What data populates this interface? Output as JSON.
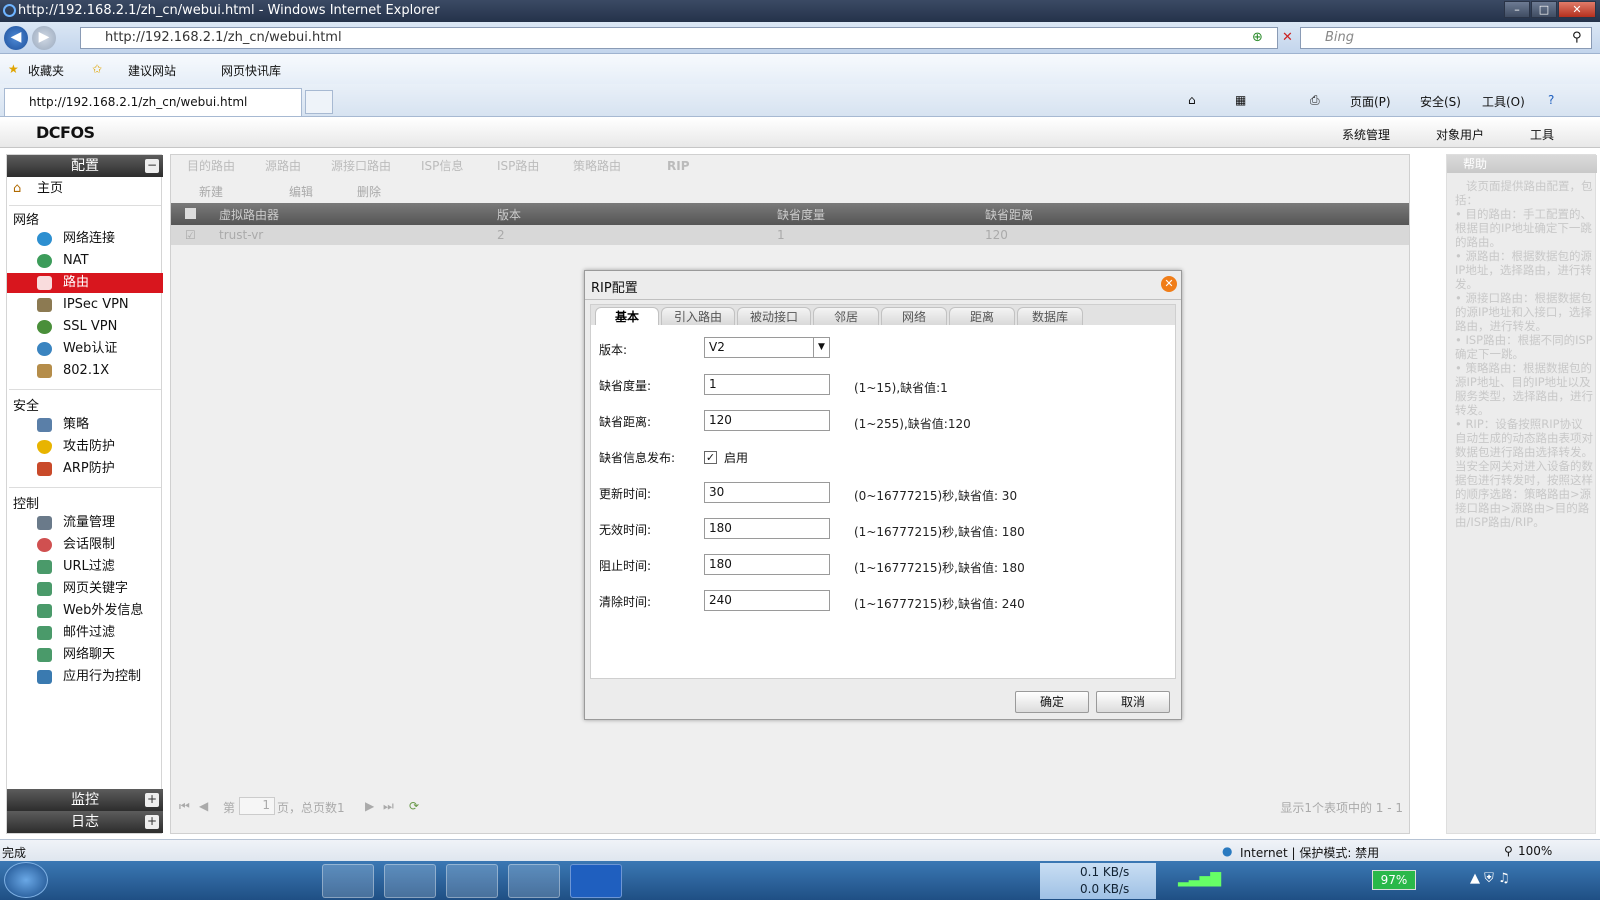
{
  "window": {
    "title": "http://192.168.2.1/zh_cn/webui.html - Windows Internet Explorer",
    "url": "http://192.168.2.1/zh_cn/webui.html",
    "search_placeholder": "Bing",
    "tab_title": "http://192.168.2.1/zh_cn/webui.html"
  },
  "favorites": {
    "fav_label": "收藏夹",
    "suggested": "建议网站",
    "webslices": "网页快讯库"
  },
  "ie_commands": {
    "page": "页面(P)",
    "safety": "安全(S)",
    "tools": "工具(O)"
  },
  "app": {
    "logo": "DCFOS",
    "menus": [
      "系统管理",
      "对象用户",
      "工具"
    ]
  },
  "sidebar": {
    "config_header": "配置",
    "home": "主页",
    "sections": {
      "network": "网络",
      "security": "安全",
      "control": "控制"
    },
    "network_items": [
      "网络连接",
      "NAT",
      "路由",
      "IPSec VPN",
      "SSL VPN",
      "Web认证",
      "802.1X"
    ],
    "security_items": [
      "策略",
      "攻击防护",
      "ARP防护"
    ],
    "control_items": [
      "流量管理",
      "会话限制",
      "URL过滤",
      "网页关键字",
      "Web外发信息",
      "邮件过滤",
      "网络聊天",
      "应用行为控制"
    ],
    "monitor_header": "监控",
    "log_header": "日志"
  },
  "main": {
    "tabs": [
      "目的路由",
      "源路由",
      "源接口路由",
      "ISP信息",
      "ISP路由",
      "策略路由",
      "RIP"
    ],
    "toolbar": {
      "new": "新建",
      "edit": "编辑",
      "delete": "删除"
    },
    "columns": [
      "虚拟路由器",
      "版本",
      "缺省度量",
      "缺省距离"
    ],
    "row": [
      "trust-vr",
      "2",
      "1",
      "120"
    ],
    "pager": {
      "page_prefix": "第",
      "page_num": "1",
      "page_suffix": "页，总页数1",
      "display": "显示1个表项中的 1 - 1"
    }
  },
  "help": {
    "title": "帮助",
    "text": "   该页面提供路由配置，包括：\n• 目的路由：手工配置的、根据目的IP地址确定下一跳的路由。\n• 源路由：根据数据包的源IP地址，选择路由，进行转发。\n• 源接口路由：根据数据包的源IP地址和入接口，选择路由，进行转发。\n• ISP路由：根据不同的ISP确定下一跳。\n• 策略路由：根据数据包的源IP地址、目的IP地址以及服务类型，选择路由，进行转发。\n• RIP：设备按照RIP协议自动生成的动态路由表项对数据包进行路由选择转发。\n当安全网关对进入设备的数据包进行转发时，按照这样的顺序选路：策略路由>源接口路由>源路由>目的路由/ISP路由/RIP。"
  },
  "dialog": {
    "title": "RIP配置",
    "tabs": [
      "基本",
      "引入路由",
      "被动接口",
      "邻居",
      "网络",
      "距离",
      "数据库"
    ],
    "fields": {
      "version_label": "版本:",
      "version_value": "V2",
      "metric_label": "缺省度量:",
      "metric_value": "1",
      "metric_hint": "(1~15),缺省值:1",
      "distance_label": "缺省距离:",
      "distance_value": "120",
      "distance_hint": "(1~255),缺省值:120",
      "info_label": "缺省信息发布:",
      "info_enable": "启用",
      "update_label": "更新时间:",
      "update_value": "30",
      "update_hint": "(0~16777215)秒,缺省值: 30",
      "invalid_label": "无效时间:",
      "invalid_value": "180",
      "invalid_hint": "(1~16777215)秒,缺省值: 180",
      "holddown_label": "阻止时间:",
      "holddown_value": "180",
      "holddown_hint": "(1~16777215)秒,缺省值: 180",
      "flush_label": "清除时间:",
      "flush_value": "240",
      "flush_hint": "(1~16777215)秒,缺省值: 240"
    },
    "ok": "确定",
    "cancel": "取消"
  },
  "statusbar": {
    "left": "完成",
    "zone": "Internet | 保护模式: 禁用",
    "zoom": "100%"
  },
  "taskbar": {
    "down_speed": "0.1 KB/s",
    "up_speed": "0.0 KB/s",
    "battery": "97%"
  },
  "colors": {
    "accent_red": "#d8161e",
    "dialog_close": "#f07d18",
    "taskbar": "#1f4f84"
  }
}
